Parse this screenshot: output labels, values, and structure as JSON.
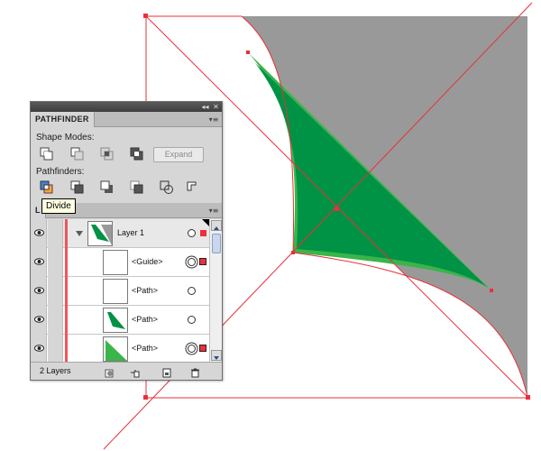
{
  "panel": {
    "collapse_glyph": "◂◂",
    "close_glyph": "✕",
    "menu_glyph": "▾≡"
  },
  "pathfinder": {
    "tab_label": "PATHFINDER",
    "shape_modes_label": "Shape Modes:",
    "shape_mode_icons": [
      "unite-icon",
      "minus-front-icon",
      "intersect-icon",
      "exclude-icon"
    ],
    "expand_label": "Expand",
    "pathfinders_label": "Pathfinders:",
    "pathfinder_icons": [
      "divide-icon",
      "trim-icon",
      "merge-icon",
      "crop-icon",
      "outline-icon",
      "minus-back-icon"
    ],
    "tooltip": "Divide"
  },
  "layers": {
    "tab_label": "L",
    "rows": [
      {
        "label": "Layer 1",
        "type": "layer",
        "target": "single",
        "selection": "filled"
      },
      {
        "label": "<Guide>",
        "type": "guide",
        "target": "double",
        "selection": "outlined"
      },
      {
        "label": "<Path>",
        "type": "path-white",
        "target": "single",
        "selection": "none"
      },
      {
        "label": "<Path>",
        "type": "path-green-small",
        "target": "single",
        "selection": "none"
      },
      {
        "label": "<Path>",
        "type": "path-green-big",
        "target": "double",
        "selection": "outlined"
      }
    ],
    "layer_count_label": "2 Layers",
    "footer_icons": [
      "make-clipping-mask-icon",
      "create-sublayer-icon",
      "new-layer-icon",
      "delete-layer-icon"
    ]
  },
  "colors": {
    "artwork_gray": "#999999",
    "artwork_green_dark": "#009245",
    "artwork_green_light": "#39b54a",
    "guide_red": "#e8303b",
    "layer_color": "#f2545a"
  }
}
